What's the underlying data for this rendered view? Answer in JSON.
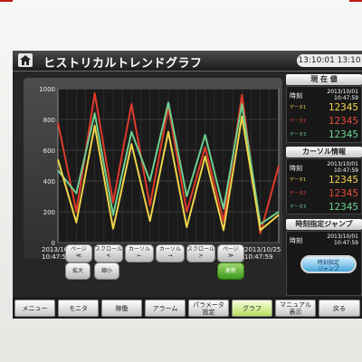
{
  "app": {
    "title": "ヒストリカルトレンドグラフ",
    "clock": "13:10:01  13:10"
  },
  "chart": {
    "start_datetime": "2013/10/01\n10:47:59",
    "end_datetime": "2013/10/25\n10:47:59",
    "buttons": [
      "ページ\n≪",
      "スクロール\n<",
      "カーソル\n←",
      "カーソル\n→",
      "スクロール\n>",
      "ページ\n≫"
    ],
    "zoom_in": "拡大",
    "zoom_out": "縮小",
    "refresh": "更新"
  },
  "chart_data": {
    "type": "line",
    "ylim": [
      0,
      1000
    ],
    "yticks": [
      "1000",
      "800",
      "600",
      "400",
      "200",
      "0"
    ],
    "x": [
      1,
      2,
      3,
      4,
      5,
      6,
      7,
      8,
      9,
      10,
      11,
      12,
      13
    ],
    "series": [
      {
        "color": "#e03a2a",
        "values": [
          780,
          200,
          970,
          260,
          900,
          240,
          880,
          200,
          620,
          140,
          960,
          60,
          500
        ]
      },
      {
        "color": "#6fd08f",
        "values": [
          470,
          320,
          840,
          180,
          720,
          400,
          910,
          300,
          700,
          220,
          900,
          120,
          200
        ]
      },
      {
        "color": "#f0d44a",
        "values": [
          540,
          130,
          760,
          90,
          640,
          140,
          720,
          100,
          560,
          80,
          820,
          80,
          180
        ]
      }
    ]
  },
  "panels": {
    "current": {
      "header": "現 在 値",
      "time_label": "時刻",
      "datetime": "2013/10/01\n10:47:59",
      "series": [
        {
          "name": "データ1",
          "value": "12345",
          "color": "#f3d24a"
        },
        {
          "name": "データ2",
          "value": "12345",
          "color": "#e44a3a"
        },
        {
          "name": "データ3",
          "value": "12345",
          "color": "#6fd08f"
        }
      ]
    },
    "cursor": {
      "header": "カーソル情報",
      "time_label": "時刻",
      "datetime": "2013/10/01\n10:47:59",
      "series": [
        {
          "name": "データ1",
          "value": "12345",
          "color": "#f3d24a"
        },
        {
          "name": "データ2",
          "value": "12345",
          "color": "#e44a3a"
        },
        {
          "name": "データ3",
          "value": "12345",
          "color": "#6fd08f"
        }
      ]
    },
    "jump": {
      "header": "時刻指定ジャンプ",
      "time_label": "時刻",
      "datetime": "2013/10/01\n10:47:59",
      "button": "時刻指定\nジャンプ"
    }
  },
  "tabs": [
    "メニュー",
    "モニタ",
    "稼働",
    "アラーム",
    "パラメータ\n設定",
    "グラフ",
    "マニュアル\n表示",
    "戻る"
  ],
  "active_tab": 5
}
